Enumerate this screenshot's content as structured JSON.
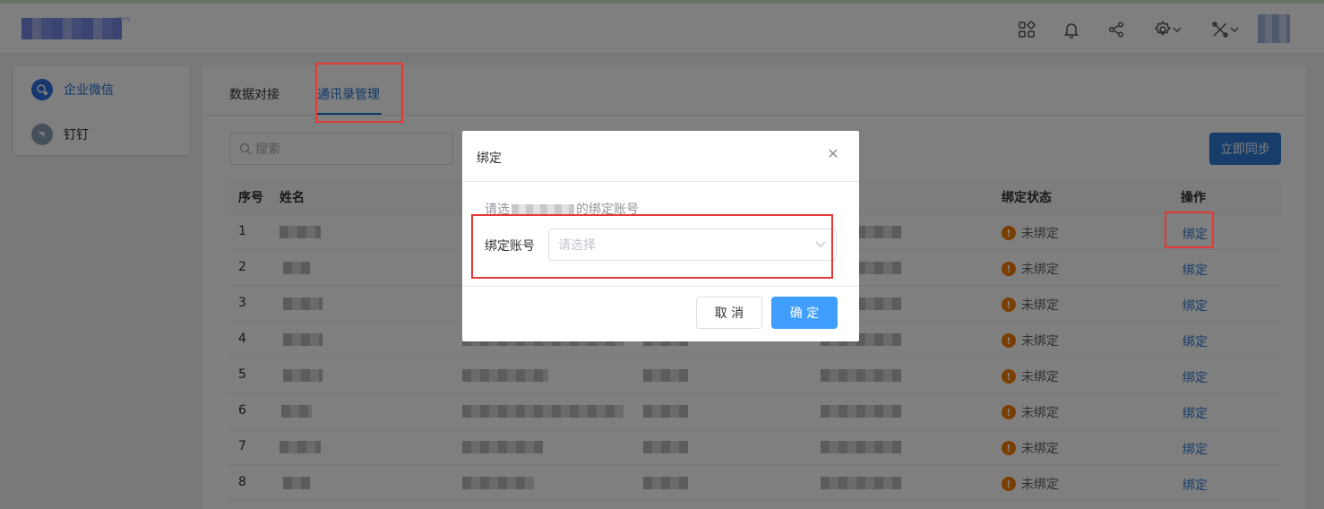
{
  "header": {
    "logo_suffix": "SYS",
    "icons": [
      "apps-icon",
      "bell-icon",
      "share-icon",
      "settings-icon",
      "tools-icon"
    ]
  },
  "sidebar": {
    "items": [
      {
        "label": "企业微信",
        "icon": "wecom-icon",
        "active": true
      },
      {
        "label": "钉钉",
        "icon": "dingtalk-icon",
        "active": false
      }
    ]
  },
  "tabs": [
    {
      "label": "数据对接",
      "active": false
    },
    {
      "label": "通讯录管理",
      "active": true
    }
  ],
  "toolbar": {
    "search_placeholder": "搜索",
    "sync_label": "立即同步"
  },
  "table": {
    "columns": {
      "index": "序号",
      "name": "姓名",
      "status": "绑定状态",
      "action": "操作"
    },
    "rows": [
      {
        "index": "1",
        "status": "未绑定",
        "action": "绑定"
      },
      {
        "index": "2",
        "status": "未绑定",
        "action": "绑定"
      },
      {
        "index": "3",
        "status": "未绑定",
        "action": "绑定"
      },
      {
        "index": "4",
        "status": "未绑定",
        "action": "绑定"
      },
      {
        "index": "5",
        "status": "未绑定",
        "action": "绑定"
      },
      {
        "index": "6",
        "status": "未绑定",
        "action": "绑定"
      },
      {
        "index": "7",
        "status": "未绑定",
        "action": "绑定"
      },
      {
        "index": "8",
        "status": "未绑定",
        "action": "绑定"
      }
    ]
  },
  "dialog": {
    "title": "绑定",
    "tip_prefix": "请选",
    "tip_suffix": "的绑定账号",
    "field_label": "绑定账号",
    "select_placeholder": "请选择",
    "cancel_label": "取 消",
    "ok_label": "确 定"
  },
  "colors": {
    "primary": "#409eff",
    "link": "#2e7bd6",
    "warning": "#f57c00",
    "highlight_box": "#e53935"
  }
}
